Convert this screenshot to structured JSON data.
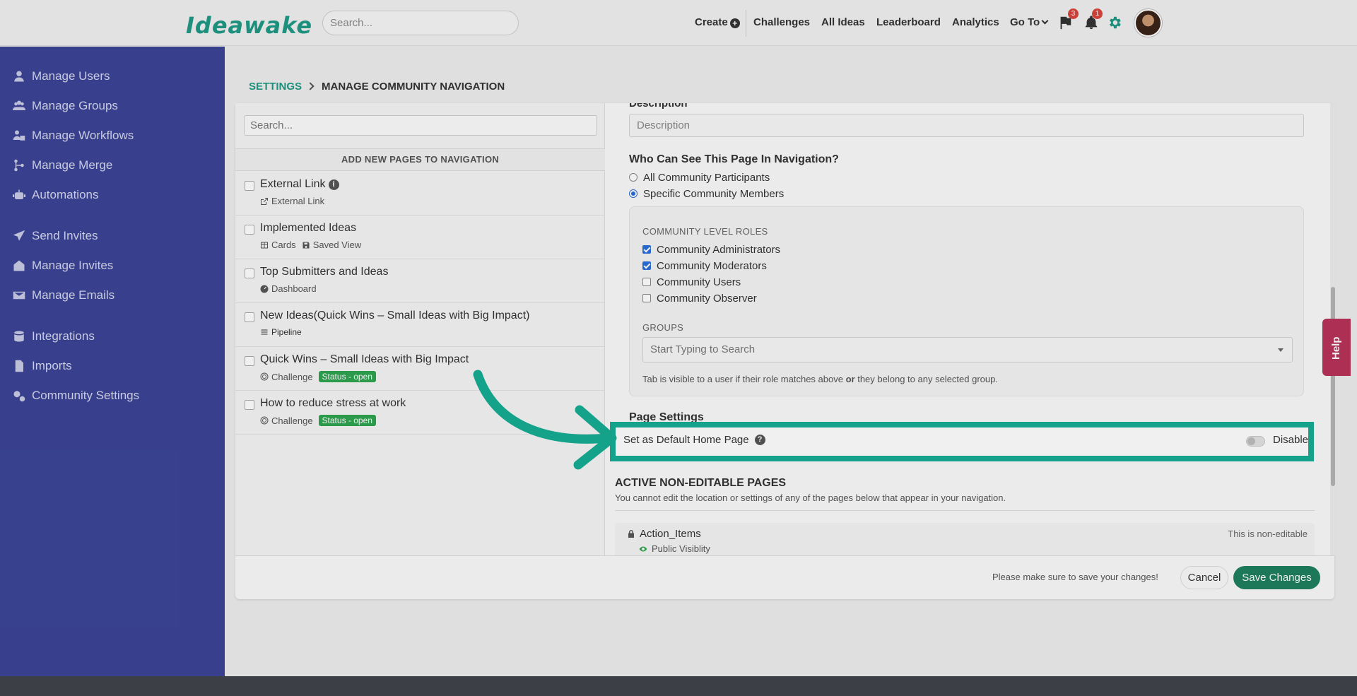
{
  "header": {
    "logo": "Ideawake",
    "search_placeholder": "Search...",
    "nav": {
      "create": "Create",
      "challenges": "Challenges",
      "all_ideas": "All Ideas",
      "leaderboard": "Leaderboard",
      "analytics": "Analytics",
      "go_to": "Go To"
    },
    "flag_badge": "3",
    "bell_badge": "1"
  },
  "sidebar": {
    "items": [
      {
        "label": "Manage Users",
        "icon": "user-icon"
      },
      {
        "label": "Manage Groups",
        "icon": "users-icon"
      },
      {
        "label": "Manage Workflows",
        "icon": "workflow-icon"
      },
      {
        "label": "Manage Merge",
        "icon": "merge-icon"
      },
      {
        "label": "Automations",
        "icon": "robot-icon"
      },
      {
        "label": "Send Invites",
        "icon": "send-icon"
      },
      {
        "label": "Manage Invites",
        "icon": "invites-icon"
      },
      {
        "label": "Manage Emails",
        "icon": "envelope-icon"
      },
      {
        "label": "Integrations",
        "icon": "database-icon"
      },
      {
        "label": "Imports",
        "icon": "file-icon"
      },
      {
        "label": "Community Settings",
        "icon": "gears-icon"
      }
    ]
  },
  "breadcrumb": {
    "root": "SETTINGS",
    "current": "MANAGE COMMUNITY NAVIGATION"
  },
  "left_panel": {
    "search_placeholder": "Search...",
    "header": "ADD NEW PAGES TO NAVIGATION",
    "pages": [
      {
        "title": "External Link",
        "meta": [
          "External Link"
        ],
        "status": ""
      },
      {
        "title": "Implemented Ideas",
        "meta": [
          "Cards",
          "Saved View"
        ],
        "status": ""
      },
      {
        "title": "Top Submitters and Ideas",
        "meta": [
          "Dashboard"
        ],
        "status": ""
      },
      {
        "title": "New Ideas(Quick Wins – Small Ideas with Big Impact)",
        "meta": [
          "Pipeline"
        ],
        "status": ""
      },
      {
        "title": "Quick Wins – Small Ideas with Big Impact",
        "meta": [
          "Challenge"
        ],
        "status": "Status - open"
      },
      {
        "title": "How to reduce stress at work",
        "meta": [
          "Challenge"
        ],
        "status": "Status - open"
      }
    ]
  },
  "right_panel": {
    "description_label": "Description",
    "description_placeholder": "Description",
    "visibility_label": "Who Can See This Page In Navigation?",
    "visibility_options": [
      {
        "label": "All Community Participants",
        "selected": false
      },
      {
        "label": "Specific Community Members",
        "selected": true
      }
    ],
    "roles_label": "COMMUNITY LEVEL ROLES",
    "roles": [
      {
        "label": "Community Administrators",
        "checked": true
      },
      {
        "label": "Community Moderators",
        "checked": true
      },
      {
        "label": "Community Users",
        "checked": false
      },
      {
        "label": "Community Observer",
        "checked": false
      }
    ],
    "groups_label": "GROUPS",
    "groups_placeholder": "Start Typing to Search",
    "tab_note_pre": "Tab is visible to a user if their role matches above",
    "tab_note_or": "or",
    "tab_note_post": "they belong to any selected group.",
    "page_settings_label": "Page Settings",
    "default_home_label": "Set as Default Home Page",
    "default_home_state": "Disabled",
    "active_label": "ACTIVE NON-EDITABLE PAGES",
    "active_note": "You cannot edit the location or settings of any of the pages below that appear in your navigation.",
    "non_editable": {
      "title": "Action_Items",
      "visibility": "Public Visiblity",
      "flag": "This is non-editable"
    }
  },
  "footer": {
    "note": "Please make sure to save your changes!",
    "cancel": "Cancel",
    "save": "Save Changes"
  },
  "help_tab": "Help",
  "colors": {
    "accent": "#1f9a85",
    "sidebar": "#3c4596",
    "highlight": "#16ad93",
    "save": "#1f7f5f"
  }
}
